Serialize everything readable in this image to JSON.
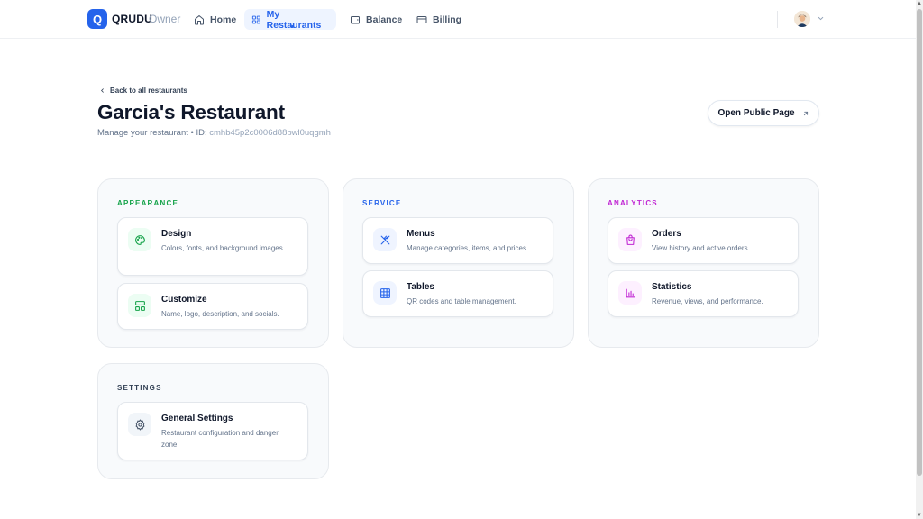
{
  "nav": {
    "logo_letter": "Q",
    "brand": "QRUDU",
    "brand_sub": "Owner",
    "items": [
      {
        "label": "Home",
        "icon": "home-icon"
      },
      {
        "label": "My Restaurants",
        "icon": "grid-icon",
        "active": true
      },
      {
        "label": "Balance",
        "icon": "wallet-icon"
      },
      {
        "label": "Billing",
        "icon": "credit-card-icon"
      }
    ],
    "avatar_icon": "user-avatar-icon"
  },
  "header": {
    "back_label": "Back to all restaurants",
    "title": "Garcia's Restaurant",
    "subtitle_prefix": "Manage your restaurant • ID: ",
    "restaurant_id": "cmhb45p2c0006d88bwl0uqgmh",
    "open_public_label": "Open Public Page"
  },
  "sections": [
    {
      "title": "APPEARANCE",
      "color": "#16a34a",
      "cards": [
        {
          "title": "Design",
          "desc": "Colors, fonts, and background images.",
          "icon": "palette-icon",
          "icon_color": "#16a34a",
          "icon_bg": "#ecfdf3"
        },
        {
          "title": "Customize",
          "desc": "Name, logo, description, and socials.",
          "icon": "layout-icon",
          "icon_color": "#16a34a",
          "icon_bg": "#ecfdf3"
        }
      ]
    },
    {
      "title": "SERVICE",
      "color": "#2563eb",
      "cards": [
        {
          "title": "Menus",
          "desc": "Manage categories, items, and prices.",
          "icon": "utensils-icon",
          "icon_color": "#2563eb",
          "icon_bg": "#eff4ff"
        },
        {
          "title": "Tables",
          "desc": "QR codes and table management.",
          "icon": "table-grid-icon",
          "icon_color": "#2563eb",
          "icon_bg": "#eff4ff"
        }
      ]
    },
    {
      "title": "ANALYTICS",
      "color": "#c026d3",
      "cards": [
        {
          "title": "Orders",
          "desc": "View history and active orders.",
          "icon": "shopping-bag-icon",
          "icon_color": "#c026d3",
          "icon_bg": "#fdf0ff"
        },
        {
          "title": "Statistics",
          "desc": "Revenue, views, and performance.",
          "icon": "bar-chart-icon",
          "icon_color": "#c026d3",
          "icon_bg": "#fdf0ff"
        }
      ]
    },
    {
      "title": "SETTINGS",
      "color": "#334155",
      "cards": [
        {
          "title": "General Settings",
          "desc": "Restaurant configuration and danger zone.",
          "icon": "gear-icon",
          "icon_color": "#475569",
          "icon_bg": "#f1f5f9"
        }
      ]
    }
  ]
}
